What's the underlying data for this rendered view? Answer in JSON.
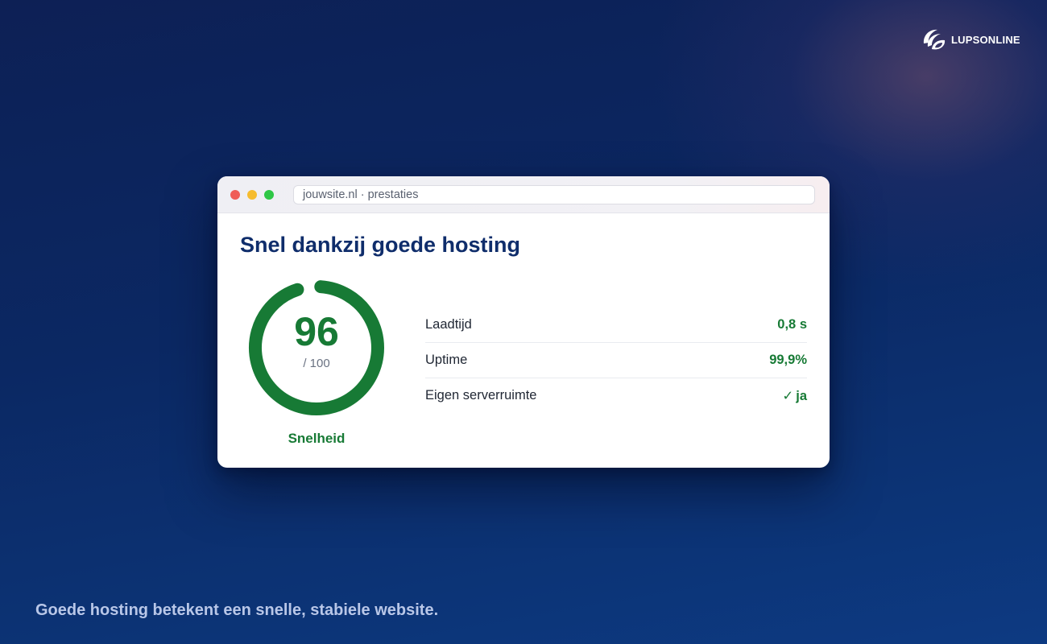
{
  "brand": {
    "name": "LUPSONLINE",
    "logo_icon": "lupsonline-logo-icon"
  },
  "browser": {
    "window_controls": [
      "close",
      "minimize",
      "maximize"
    ],
    "url": "jouwsite.nl · prestaties"
  },
  "card": {
    "title": "Snel dankzij goede hosting",
    "gauge": {
      "score": "96",
      "max_label": "/ 100",
      "score_value": 96,
      "score_max": 100,
      "label": "Snelheid",
      "color": "#177a35"
    },
    "metrics": [
      {
        "label": "Laadtijd",
        "value": "0,8 s"
      },
      {
        "label": "Uptime",
        "value": "99,9%"
      },
      {
        "label": "Eigen serverruimte",
        "value": "ja",
        "icon": "check-icon"
      }
    ]
  },
  "tagline": "Goede hosting betekent een snelle, stabiele website.",
  "colors": {
    "background": "#0b2863",
    "heading": "#0f2d6b",
    "accent_green": "#177a35",
    "tagline": "#b9c7e8"
  }
}
